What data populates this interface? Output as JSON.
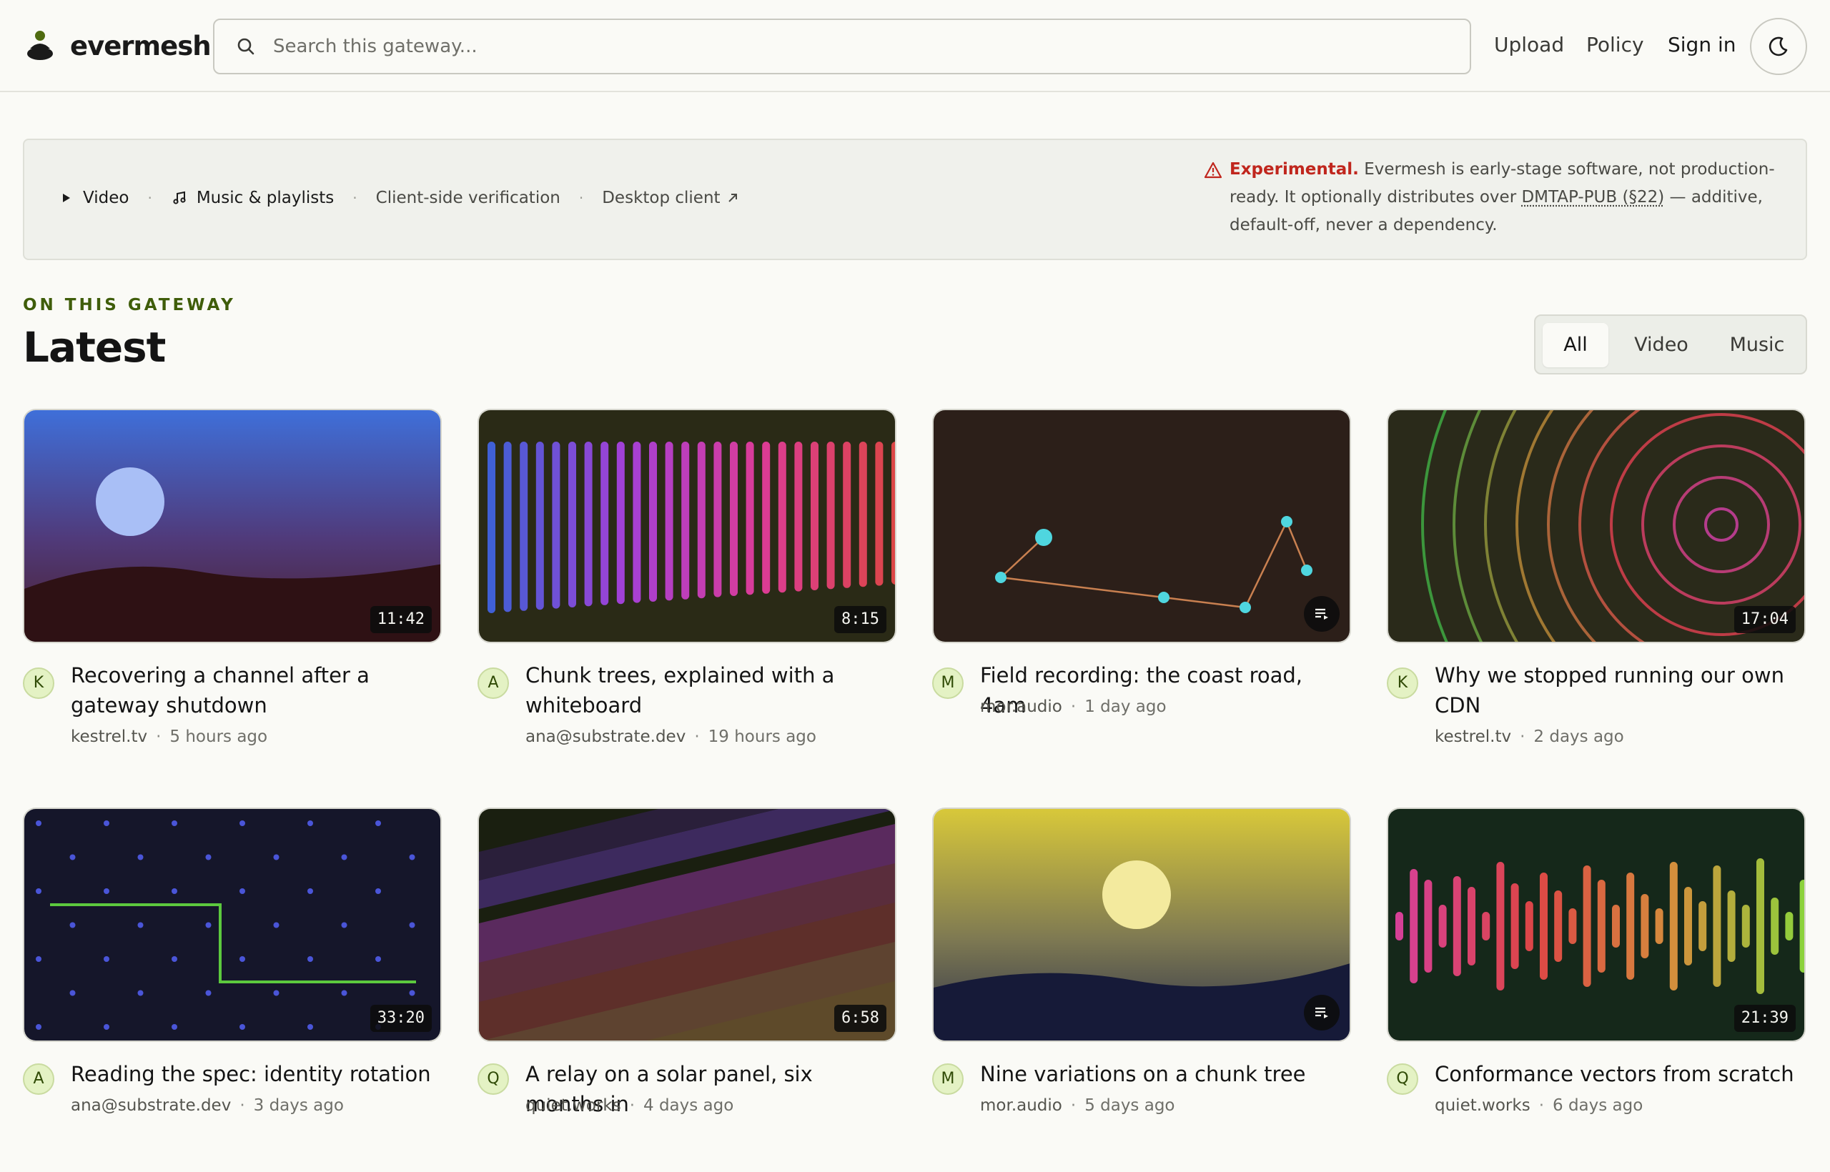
{
  "header": {
    "brand": "evermesh",
    "search_placeholder": "Search this gateway...",
    "nav": {
      "upload": "Upload",
      "policy": "Policy",
      "signin": "Sign in"
    },
    "icons": {
      "search": "search-icon",
      "theme": "moon-icon",
      "logo": "stacked-stones-logo"
    }
  },
  "banner": {
    "links": [
      {
        "label": "Video",
        "icon": "play-icon"
      },
      {
        "label": "Music & playlists",
        "icon": "music-note-icon"
      },
      {
        "label": "Client-side verification"
      },
      {
        "label": "Desktop client",
        "icon": "external-arrow-icon"
      }
    ],
    "warning": {
      "strong": "Experimental.",
      "text1": " Evermesh is early-stage software, not production-ready. It optionally distributes over ",
      "link": "DMTAP-PUB (§22)",
      "text2": " — additive, default-off, never a dependency."
    }
  },
  "section": {
    "kicker": "ON THIS GATEWAY",
    "title": "Latest",
    "filters": [
      "All",
      "Video",
      "Music"
    ],
    "active_filter": "All"
  },
  "cards": [
    {
      "title": "Recovering a channel after a gateway shutdown",
      "channel": "kestrel.tv",
      "avatar": "K",
      "ago": "5 hours ago",
      "duration": "11:42",
      "kind": "video"
    },
    {
      "title": "Chunk trees, explained with a whiteboard",
      "channel": "ana@substrate.dev",
      "avatar": "A",
      "ago": "19 hours ago",
      "duration": "8:15",
      "kind": "video"
    },
    {
      "title": "Field recording: the coast road, 4am",
      "channel": "mor.audio",
      "avatar": "M",
      "ago": "1 day ago",
      "duration": "",
      "kind": "playlist"
    },
    {
      "title": "Why we stopped running our own CDN",
      "channel": "kestrel.tv",
      "avatar": "K",
      "ago": "2 days ago",
      "duration": "17:04",
      "kind": "video"
    },
    {
      "title": "Reading the spec: identity rotation",
      "channel": "ana@substrate.dev",
      "avatar": "A",
      "ago": "3 days ago",
      "duration": "33:20",
      "kind": "video"
    },
    {
      "title": "A relay on a solar panel, six months in",
      "channel": "quiet.works",
      "avatar": "Q",
      "ago": "4 days ago",
      "duration": "6:58",
      "kind": "video"
    },
    {
      "title": "Nine variations on a chunk tree",
      "channel": "mor.audio",
      "avatar": "M",
      "ago": "5 days ago",
      "duration": "",
      "kind": "playlist"
    },
    {
      "title": "Conformance vectors from scratch",
      "channel": "quiet.works",
      "avatar": "Q",
      "ago": "6 days ago",
      "duration": "21:39",
      "kind": "video"
    }
  ],
  "colors": {
    "accent": "#3f5d0a",
    "warning": "#c0261d",
    "background": "#fafaf6"
  }
}
